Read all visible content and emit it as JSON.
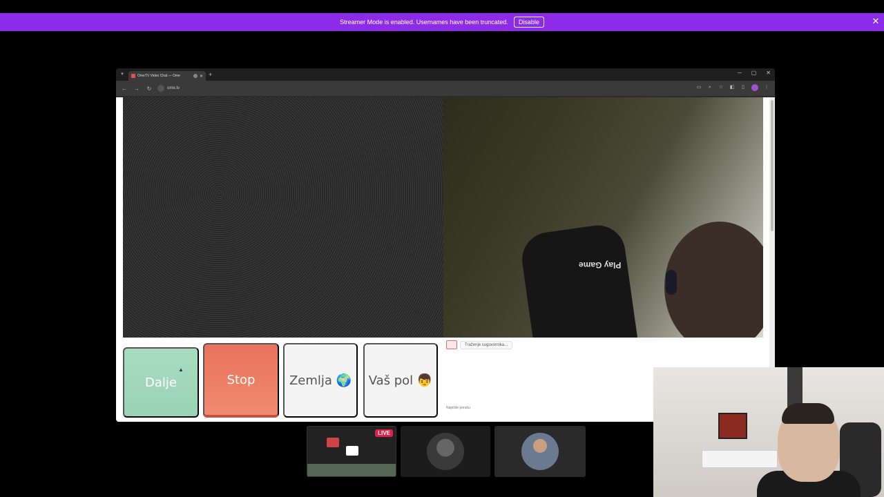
{
  "banner": {
    "message": "Streamer Mode is enabled. Usernames have been truncated.",
    "disable_label": "Disable",
    "close_glyph": "✕"
  },
  "browser": {
    "tab_title": "OmeTV Video Chat — Ome",
    "tab_close": "✕",
    "new_tab": "+",
    "url": "ome.tv",
    "win_minimize": "─",
    "win_maximize": "▢",
    "win_close": "✕"
  },
  "omegle": {
    "btn_next": "Dalje",
    "btn_stop": "Stop",
    "btn_country": "Zemlja 🌍",
    "btn_gender": "Vaš pol 👦",
    "remote_logo_text": "Play Game",
    "system_message": "Traženje sugovornika...",
    "chat_placeholder": "Napišite poruku"
  },
  "thumbnails": {
    "live_badge": "LIVE"
  },
  "colors": {
    "banner": "#8c2be8",
    "next_button": "#a7dcc0",
    "stop_button": "#e8735a",
    "live_badge": "#e0204a"
  }
}
